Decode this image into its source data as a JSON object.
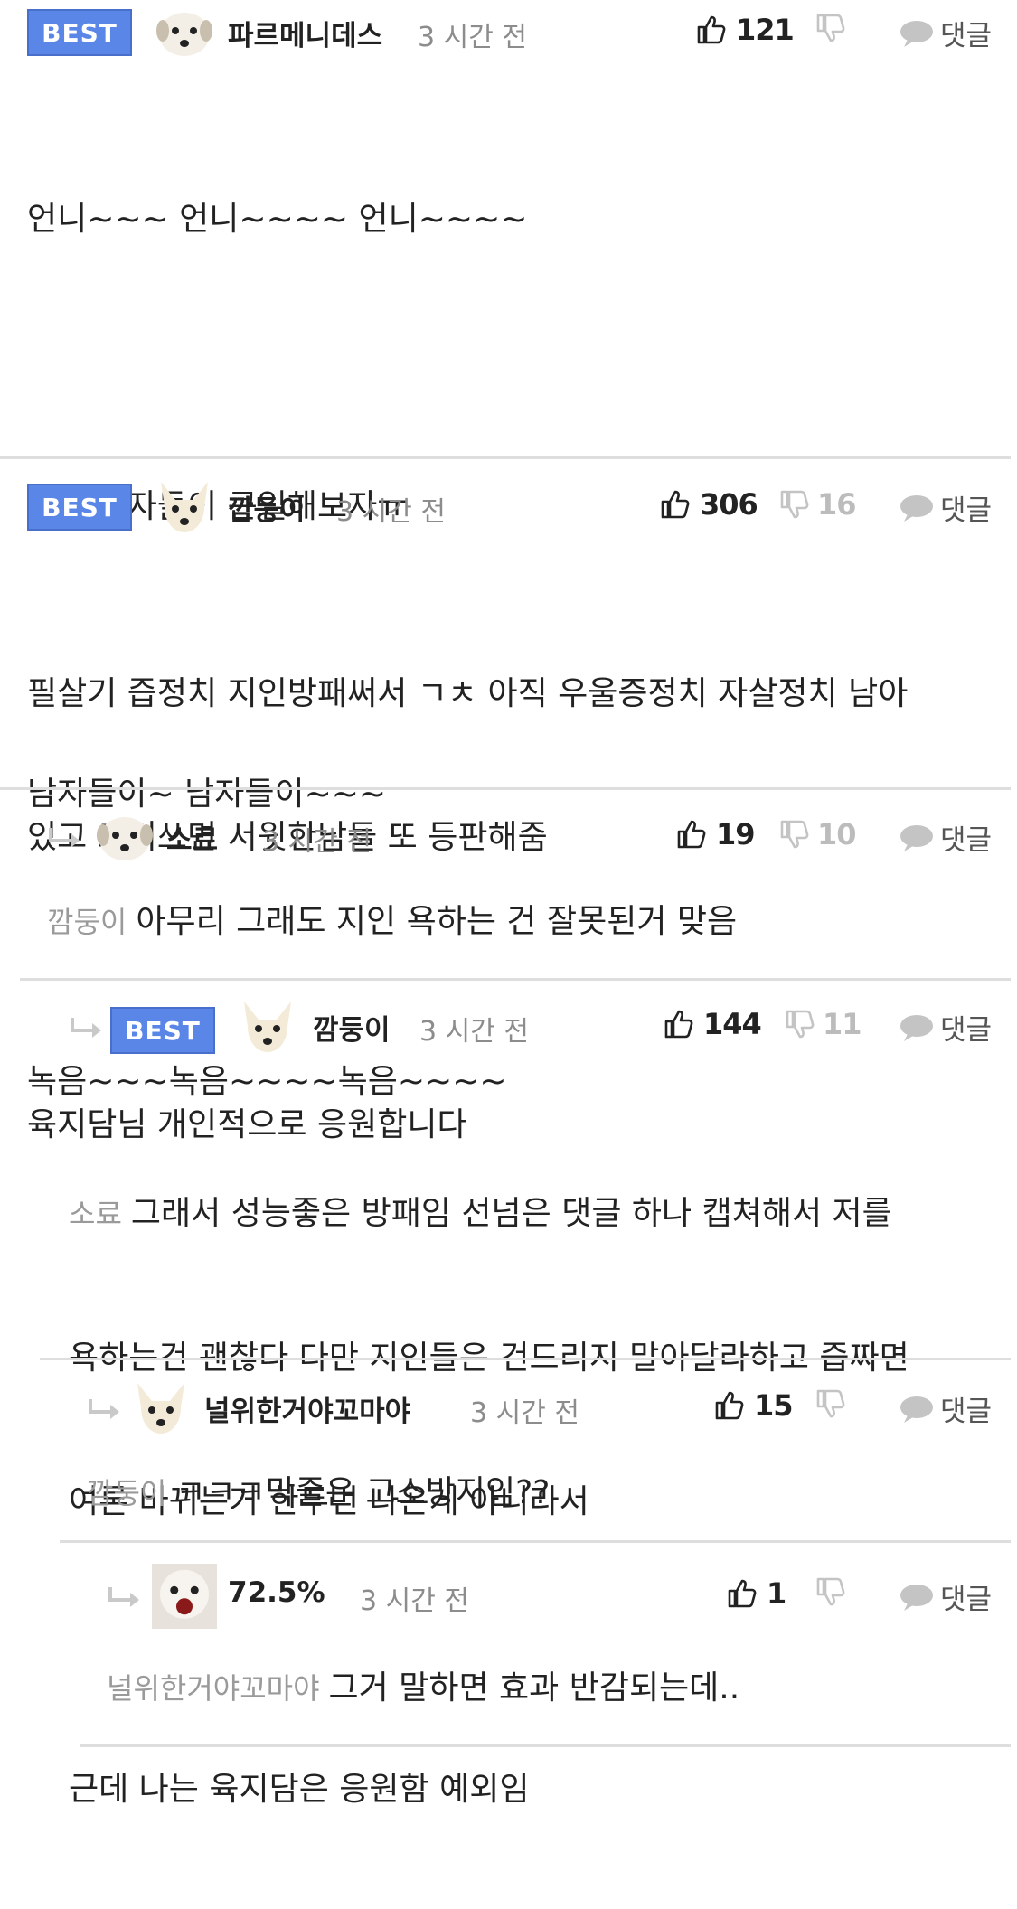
{
  "comments": [
    {
      "best": "BEST",
      "nickname": "파르메니데스",
      "time": "3 시간 전",
      "likes": "121",
      "dislikes": "",
      "reply_label": "댓글",
      "lines": [
        "언니~~~ 언니~~~~ 언니~~~~",
        "",
        "우리 여자들이 큰일해보자ㅠ",
        "",
        "남자들이~ 남자들이~~~",
        "",
        "녹음~~~녹음~~~~녹음~~~~"
      ]
    },
    {
      "best": "BEST",
      "nickname": "깜둥이",
      "time": "3 시간 전",
      "likes": "306",
      "dislikes": "16",
      "reply_label": "댓글",
      "lines": [
        "필살기 즙정치 지인방패써서 ㄱㅊ 아직 우울증정치 자살정치 남아",
        "있고 그거쓰면 서윗한남들 또 등판해줌",
        "",
        "육지담님 개인적으로 응원합니다"
      ]
    },
    {
      "best": "",
      "nickname": "소료",
      "time": "3 시간 전",
      "likes": "19",
      "dislikes": "10",
      "reply_label": "댓글",
      "mention": "깜둥이",
      "text": "아무리 그래도 지인 욕하는 건 잘못된거 맞음"
    },
    {
      "best": "BEST",
      "nickname": "깜둥이",
      "time": "3 시간 전",
      "likes": "144",
      "dislikes": "11",
      "reply_label": "댓글",
      "mention": "소료",
      "lines": [
        "그래서 성능좋은 방패임 선넘은 댓글 하나 캡쳐해서 저를",
        "욕하는건 괜찮다 다만 지인들은 건드리지 말아달라하고 즙짜면",
        "여론 바뀌는거 한두번 나온게 아니라서",
        "",
        "근데 나는 육지담은 응원함 예외임"
      ]
    },
    {
      "best": "",
      "nickname": "널위한거야꼬마야",
      "time": "3 시간 전",
      "likes": "15",
      "dislikes": "",
      "reply_label": "댓글",
      "mention": "깜둥이",
      "text": "ㅋㅋㅋ막줄은 고소방지임??"
    },
    {
      "best": "",
      "nickname": "72.5%",
      "time": "3 시간 전",
      "likes": "1",
      "dislikes": "",
      "reply_label": "댓글",
      "mention": "널위한거야꼬마야",
      "text": "그거 말하면 효과 반감되는데.."
    }
  ],
  "colors": {
    "best_bg": "#5a86e8",
    "muted": "#8c8c8c",
    "separator": "#dedede"
  },
  "icons": [
    "thumbs-up-icon",
    "thumbs-down-icon",
    "speech-bubble-icon",
    "reply-arrow-icon",
    "dog-avatar"
  ]
}
